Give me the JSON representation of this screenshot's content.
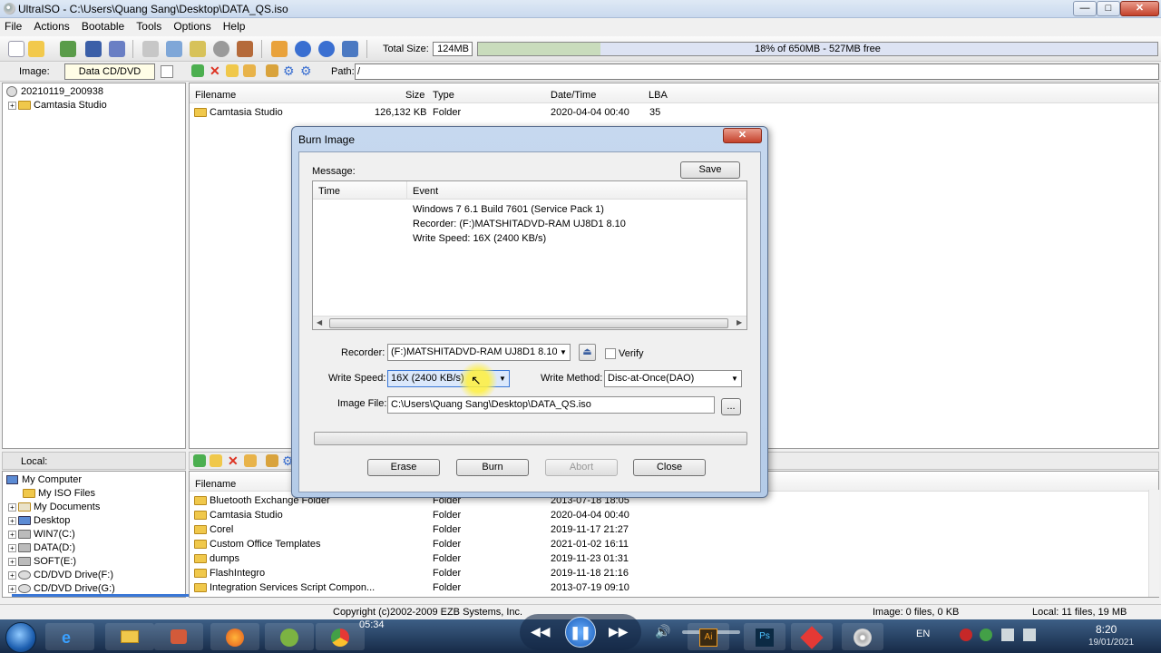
{
  "titlebar": {
    "title": "UltraISO - C:\\Users\\Quang Sang\\Desktop\\DATA_QS.iso",
    "min": "—",
    "max": "□",
    "close": "✕"
  },
  "menubar": {
    "items": [
      "File",
      "Actions",
      "Bootable",
      "Tools",
      "Options",
      "Help"
    ]
  },
  "toolbar": {
    "total_size_label": "Total Size:",
    "total_size_value": "124MB",
    "progress_text": "18% of 650MB - 527MB free",
    "progress_fraction": 0.18
  },
  "imagebar": {
    "image_label": "Image:",
    "image_type": "Data CD/DVD",
    "path_label": "Path:",
    "path_value": "/"
  },
  "iso_tree": {
    "root": "20210119_200938",
    "items": [
      "Camtasia Studio"
    ]
  },
  "iso_list": {
    "headers": {
      "filename": "Filename",
      "size": "Size",
      "type": "Type",
      "datetime": "Date/Time",
      "lba": "LBA"
    },
    "rows": [
      {
        "name": "Camtasia Studio",
        "size": "126,132 KB",
        "type": "Folder",
        "date": "2020-04-04 00:40",
        "lba": "35"
      }
    ]
  },
  "local": {
    "label": "Local:",
    "tree": [
      "My Computer",
      "My ISO Files",
      "My Documents",
      "Desktop",
      "WIN7(C:)",
      "DATA(D:)",
      "SOFT(E:)",
      "CD/DVD Drive(F:)",
      "CD/DVD Drive(G:)"
    ],
    "header_filename": "Filename",
    "rows": [
      {
        "name": "Bluetooth Exchange Folder",
        "type": "Folder",
        "date": "2013-07-18 18:05"
      },
      {
        "name": "Camtasia Studio",
        "type": "Folder",
        "date": "2020-04-04 00:40"
      },
      {
        "name": "Corel",
        "type": "Folder",
        "date": "2019-11-17 21:27"
      },
      {
        "name": "Custom Office Templates",
        "type": "Folder",
        "date": "2021-01-02 16:11"
      },
      {
        "name": "dumps",
        "type": "Folder",
        "date": "2019-11-23 01:31"
      },
      {
        "name": "FlashIntegro",
        "type": "Folder",
        "date": "2019-11-18 21:16"
      },
      {
        "name": "Integration Services Script Compon...",
        "type": "Folder",
        "date": "2013-07-19 09:10"
      }
    ]
  },
  "statusbar": {
    "copyright": "Copyright (c)2002-2009 EZB Systems, Inc.",
    "image_info": "Image: 0 files, 0 KB",
    "local_info": "Local: 11 files, 19 MB"
  },
  "dialog": {
    "title": "Burn Image",
    "message_label": "Message:",
    "save_label": "Save",
    "log_headers": {
      "time": "Time",
      "event": "Event"
    },
    "log_lines": [
      "Windows 7 6.1 Build 7601 (Service Pack 1)",
      "Recorder: (F:)MATSHITADVD-RAM UJ8D1   8.10",
      "Write Speed: 16X (2400 KB/s)"
    ],
    "recorder_label": "Recorder:",
    "recorder_value": "(F:)MATSHITADVD-RAM UJ8D1   8.10",
    "verify_label": "Verify",
    "write_speed_label": "Write Speed:",
    "write_speed_value": "16X (2400 KB/s)",
    "write_method_label": "Write Method:",
    "write_method_value": "Disc-at-Once(DAO)",
    "image_file_label": "Image File:",
    "image_file_value": "C:\\Users\\Quang Sang\\Desktop\\DATA_QS.iso",
    "browse_label": "...",
    "buttons": {
      "erase": "Erase",
      "burn": "Burn",
      "abort": "Abort",
      "close": "Close"
    }
  },
  "taskbar": {
    "time": "8:20",
    "date": "19/01/2021",
    "lang": "EN",
    "media_time": "05:34"
  }
}
